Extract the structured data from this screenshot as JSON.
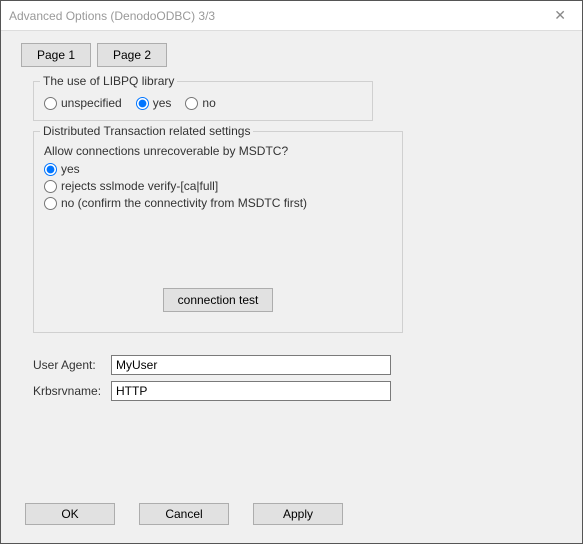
{
  "window": {
    "title": "Advanced Options (DenodoODBC) 3/3"
  },
  "tabs": {
    "page1": "Page 1",
    "page2": "Page 2"
  },
  "libpq": {
    "legend": "The use of LIBPQ library",
    "opt_unspecified": "unspecified",
    "opt_yes": "yes",
    "opt_no": "no",
    "selected": "yes"
  },
  "dtx": {
    "legend": "Distributed Transaction related settings",
    "question": "Allow connections unrecoverable by MSDTC?",
    "opt_yes": "yes",
    "opt_rejects": "rejects sslmode verify-[ca|full]",
    "opt_no": "no (confirm the connectivity from MSDTC first)",
    "selected": "yes",
    "conn_test": "connection test"
  },
  "fields": {
    "user_agent_label": "User Agent:",
    "user_agent_value": "MyUser",
    "krb_label": "Krbsrvname:",
    "krb_value": "HTTP"
  },
  "buttons": {
    "ok": "OK",
    "cancel": "Cancel",
    "apply": "Apply"
  }
}
